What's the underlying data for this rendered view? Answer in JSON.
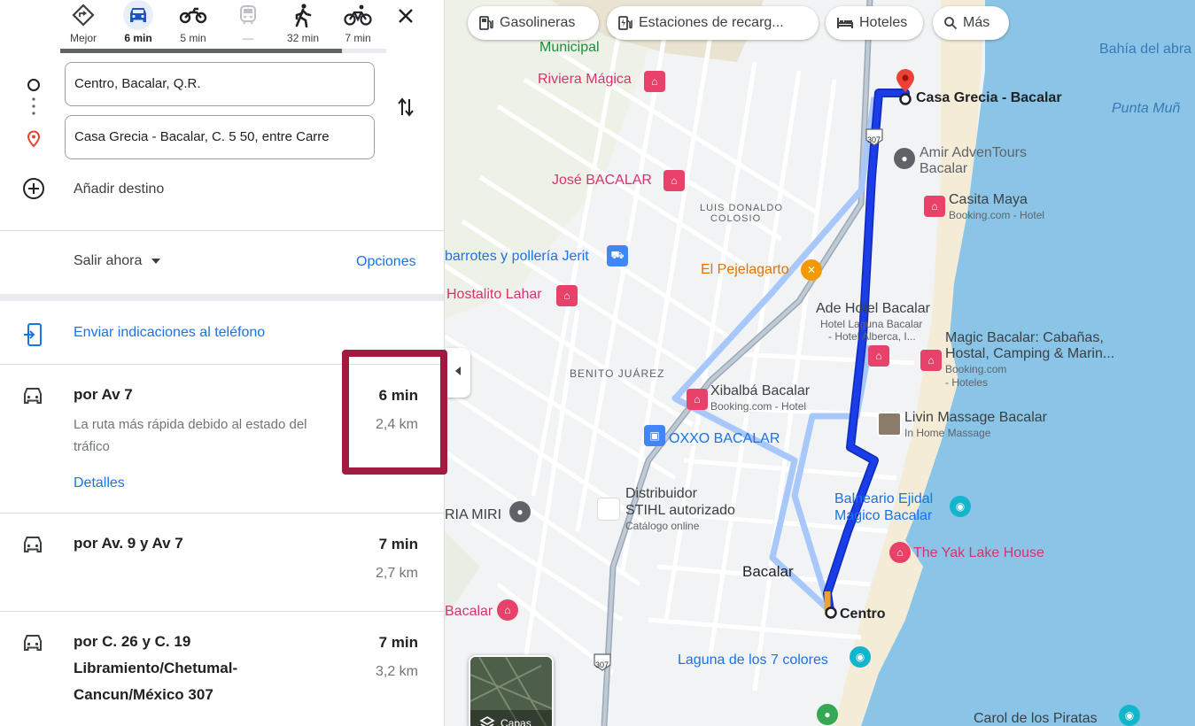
{
  "travel_modes": [
    {
      "name": "best",
      "label": "Mejor"
    },
    {
      "name": "driving",
      "label": "6 min"
    },
    {
      "name": "motorcycle",
      "label": "5 min"
    },
    {
      "name": "transit",
      "label": "—"
    },
    {
      "name": "walking",
      "label": "32 min"
    },
    {
      "name": "cycling",
      "label": "7 min"
    }
  ],
  "origin": {
    "value": "Centro, Bacalar, Q.R."
  },
  "destination": {
    "value": "Casa Grecia - Bacalar, C. 5 50, entre Carre"
  },
  "add_destination_label": "Añadir destino",
  "depart_label": "Salir ahora",
  "options_label": "Opciones",
  "send_label": "Enviar indicaciones al teléfono",
  "routes": [
    {
      "name": "por Av 7",
      "desc": "La ruta más rápida debido al estado del tráfico",
      "details": "Detalles",
      "time": "6 min",
      "distance": "2,4 km"
    },
    {
      "name": "por Av. 9 y Av 7",
      "time": "7 min",
      "distance": "2,7 km"
    },
    {
      "name": "por C. 26 y C. 19 Libramiento/Chetumal-Cancun/México 307",
      "time": "7 min",
      "distance": "3,2 km"
    }
  ],
  "chips": [
    "Gasolineras",
    "Estaciones de recarg...",
    "Hoteles",
    "Más"
  ],
  "layers_label": "Capas",
  "map_labels": {
    "municipal": "Municipal",
    "riviera": "Riviera Mágica",
    "jose": "José BACALAR",
    "luis": "LUIS DONALDO",
    "colosio": "COLOSIO",
    "abarrotes": "barrotes y pollería Jerit",
    "hostalito": "Hostalito Lahar",
    "pejelagarto": "El Pejelagarto",
    "ade": "Ade Hotel Bacalar",
    "ade_sub1": "Hotel Laguna Bacalar",
    "ade_sub2": "- Hotel Alberca, I...",
    "magic1": "Magic Bacalar: Cabañas,",
    "magic2": "Hostal, Camping & Marin...",
    "magic_sub1": "Booking.com",
    "magic_sub2": "- Hoteles",
    "benito": "BENITO JUÁREZ",
    "xibalba": "Xibalbá Bacalar",
    "xibalba_sub": "Booking.com - Hotel",
    "oxxo": "OXXO BACALAR",
    "livin": "Livin Massage Bacalar",
    "livin_sub": "In Home Massage",
    "distribuidor1": "Distribuidor",
    "distribuidor2": "STIHL autorizado",
    "distribuidor_sub": "Catálogo online",
    "balneario1": "Balneario Ejidal",
    "balneario2": "Magico Bacalar",
    "yak": "The Yak Lake House",
    "riamiri": "RIA MIRI",
    "bacalar": "Bacalar",
    "centro": "Centro",
    "bacalar_left": "Bacalar",
    "laguna": "Laguna de los 7 colores",
    "pirata": "Carol de los Piratas",
    "casa_grecia": "Casa Grecia - Bacalar",
    "amir1": "Amir AdvenTours",
    "amir2": "Bacalar",
    "casita": "Casita Maya",
    "casita_sub": "Booking.com - Hotel",
    "bahia": "Bahía del abra",
    "punta": "Punta Muñ",
    "hwy1": "307",
    "hwy2": "307"
  },
  "colors": {
    "route_primary": "#1a3de8",
    "route_alt": "#a8c7fa",
    "lake": "#8ac5e8",
    "brand_blue": "#1a73e8",
    "highlight": "#a11a3f"
  }
}
